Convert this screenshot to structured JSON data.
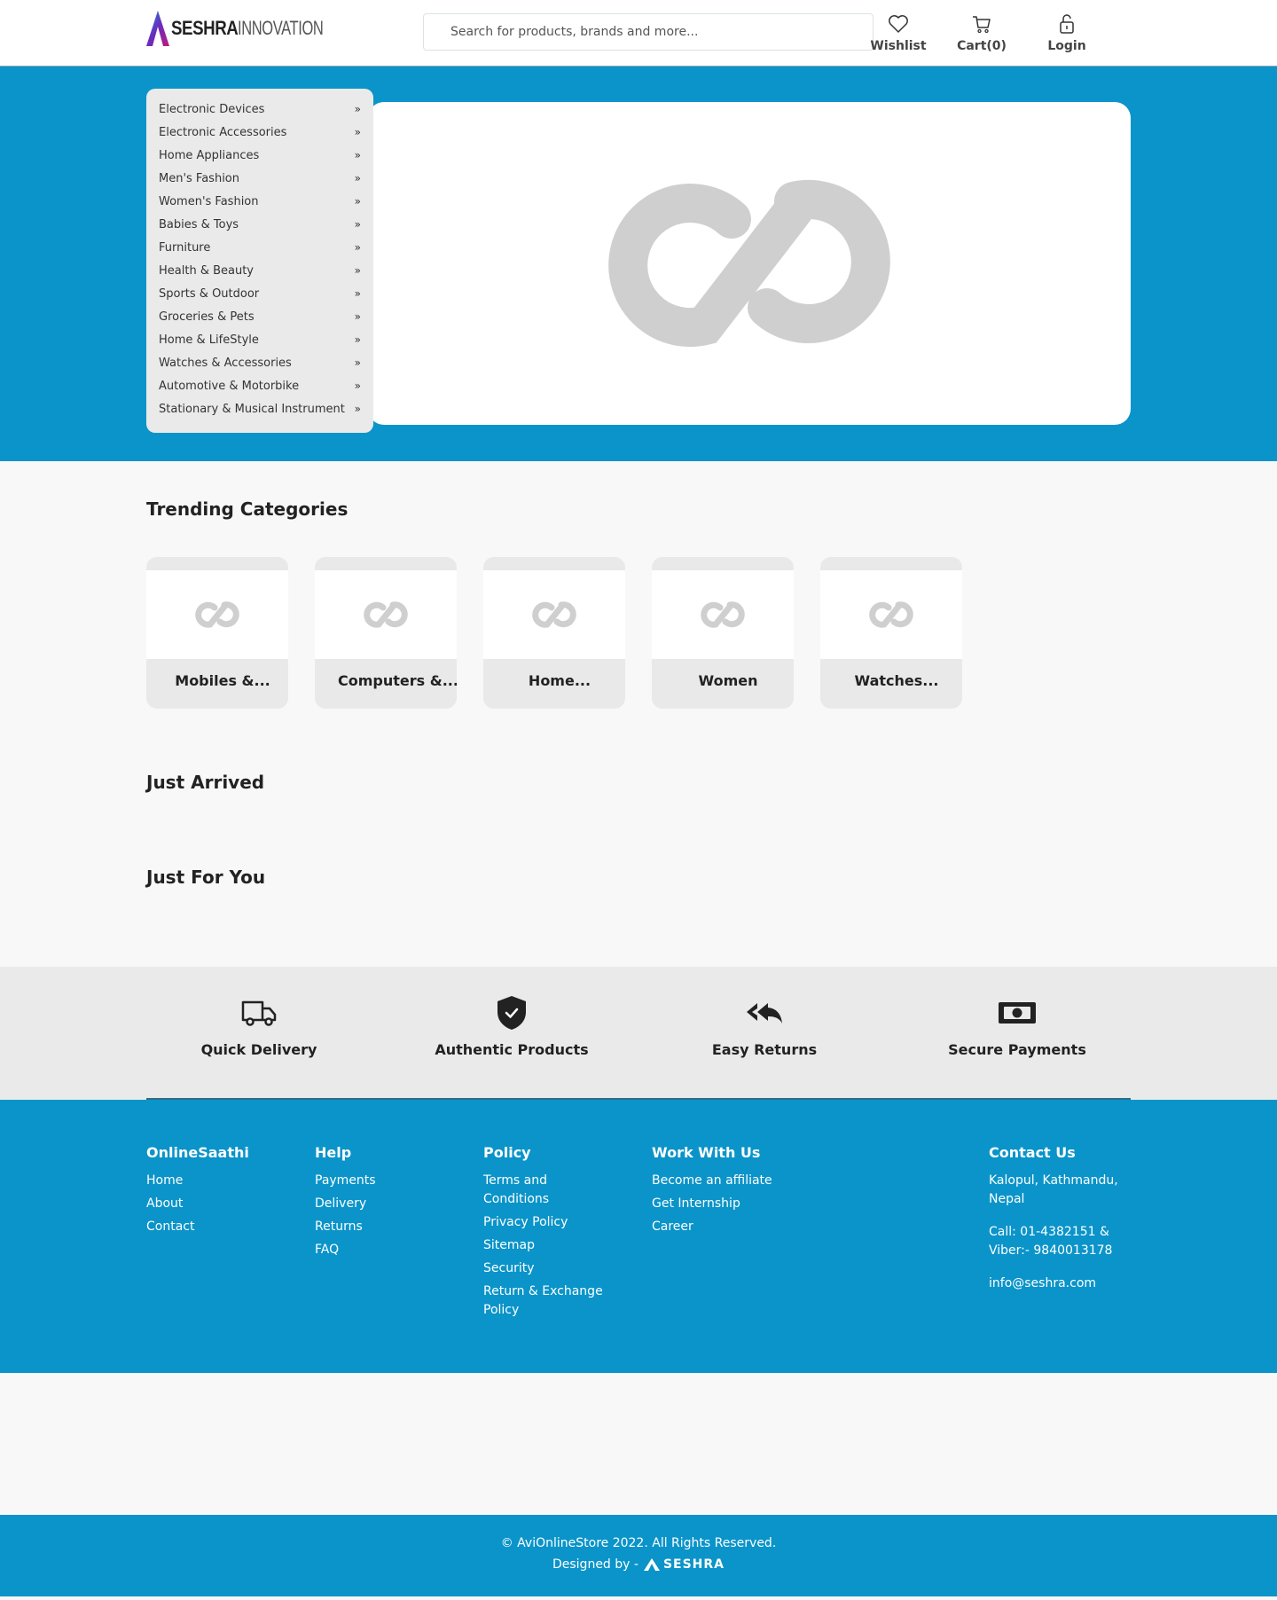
{
  "brand": {
    "logo_bold": "SESHRA",
    "logo_light": "INNOVATION"
  },
  "search": {
    "placeholder": "Search for products, brands and more..."
  },
  "header_actions": {
    "wishlist": "Wishlist",
    "cart": "Cart(0)",
    "login": "Login"
  },
  "categories": [
    "Electronic Devices",
    "Electronic Accessories",
    "Home Appliances",
    "Men's Fashion",
    "Women's Fashion",
    "Babies & Toys",
    "Furniture",
    "Health & Beauty",
    "Sports & Outdoor",
    "Groceries & Pets",
    "Home & LifeStyle",
    "Watches & Accessories",
    "Automotive & Motorbike",
    "Stationary & Musical Instrument"
  ],
  "category_arrow": "»",
  "trending": {
    "title": "Trending Categories",
    "items": [
      "Mobiles &...",
      "Computers &...",
      "Home...",
      "Women",
      "Watches..."
    ]
  },
  "just_arrived": {
    "title": "Just Arrived"
  },
  "just_for_you": {
    "title": "Just For You"
  },
  "features": [
    "Quick Delivery",
    "Authentic Products",
    "Easy Returns",
    "Secure Payments"
  ],
  "footer": {
    "col1": {
      "title": "OnlineSaathi",
      "links": [
        "Home",
        "About",
        "Contact"
      ]
    },
    "col2": {
      "title": "Help",
      "links": [
        "Payments",
        "Delivery",
        "Returns",
        "FAQ"
      ]
    },
    "col3": {
      "title": "Policy",
      "links": [
        "Terms and Conditions",
        "Privacy Policy",
        "Sitemap",
        "Security",
        "Return & Exchange Policy"
      ]
    },
    "col4": {
      "title": "Work With Us",
      "links": [
        "Become an affiliate",
        "Get Internship",
        "Career"
      ]
    },
    "contact": {
      "title": "Contact Us",
      "address": "Kalopul, Kathmandu, Nepal",
      "phone": "Call: 01-4382151 & Viber:- 9840013178",
      "email": "info@seshra.com"
    }
  },
  "copyright": "© AviOnlineStore 2022. All Rights Reserved.",
  "designed_by": "Designed by -",
  "designer_brand": "SESHRA",
  "colors": {
    "primary": "#0a94c9",
    "menu_bg": "#eaeaea"
  }
}
